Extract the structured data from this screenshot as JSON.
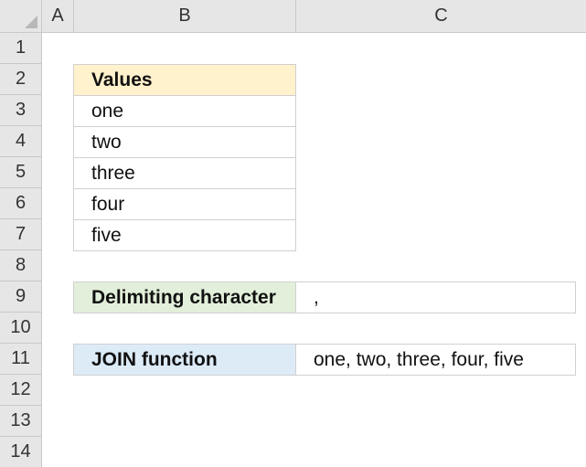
{
  "columns": [
    "A",
    "B",
    "C"
  ],
  "rows": [
    "1",
    "2",
    "3",
    "4",
    "5",
    "6",
    "7",
    "8",
    "9",
    "10",
    "11",
    "12",
    "13",
    "14"
  ],
  "values_table": {
    "header": "Values",
    "items": [
      "one",
      "two",
      "three",
      "four",
      "five"
    ]
  },
  "delimiter_row": {
    "label": "Delimiting character",
    "value": ","
  },
  "join_row": {
    "label": "JOIN function",
    "value": "one, two, three, four, five"
  },
  "colors": {
    "header_fill": "#e6e6e6",
    "values_header_fill": "#fff2cc",
    "delimiter_fill": "#e2efda",
    "join_fill": "#ddebf7"
  }
}
